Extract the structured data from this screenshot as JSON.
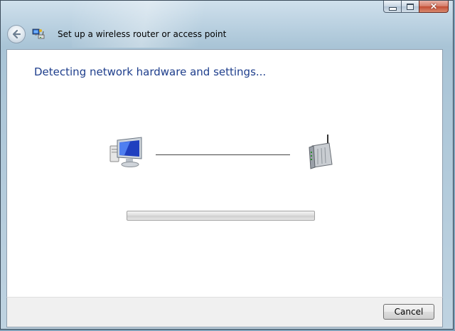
{
  "window": {
    "title": "Set up a wireless router or access point",
    "caption_buttons": [
      "minimize-icon",
      "maximize-icon",
      "close-icon"
    ]
  },
  "content": {
    "heading": "Detecting network hardware and settings...",
    "left_device_icon": "computer-icon",
    "right_device_icon": "router-icon",
    "progress": 0.0
  },
  "footer": {
    "cancel_label": "Cancel"
  },
  "colors": {
    "heading": "#1e3e8c",
    "content_bg": "#ffffff",
    "footer_bg": "#f0f0f0"
  }
}
